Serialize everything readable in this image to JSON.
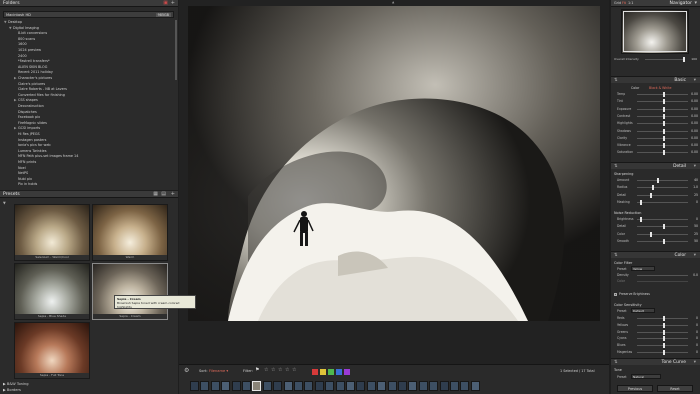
{
  "folders": {
    "title": "Folders",
    "volume_label": "Macintosh HD",
    "volume_size": "985GB",
    "tree": [
      {
        "label": "Desktop",
        "depth": 1,
        "arrow": "▼"
      },
      {
        "label": "Digital Imaging",
        "depth": 2,
        "arrow": "▼"
      },
      {
        "label": "8-bit conversions",
        "depth": 3,
        "arrow": ""
      },
      {
        "label": "800 scans",
        "depth": 3,
        "arrow": ""
      },
      {
        "label": "1600",
        "depth": 3,
        "arrow": ""
      },
      {
        "label": "1024 preview",
        "depth": 3,
        "arrow": ""
      },
      {
        "label": "2400",
        "depth": 3,
        "arrow": ""
      },
      {
        "label": "*Fastrell transfers*",
        "depth": 3,
        "arrow": ""
      },
      {
        "label": "ALIEN SKIN BLOG",
        "depth": 3,
        "arrow": ""
      },
      {
        "label": "Recent 2011 holiday",
        "depth": 3,
        "arrow": ""
      },
      {
        "label": "Character's pictures",
        "depth": 3,
        "arrow": "▶"
      },
      {
        "label": "Claire's pictures",
        "depth": 3,
        "arrow": ""
      },
      {
        "label": "Claire Roberts - NB at Lavers",
        "depth": 3,
        "arrow": ""
      },
      {
        "label": "Converted files for finishing",
        "depth": 3,
        "arrow": ""
      },
      {
        "label": "CSS shapes",
        "depth": 3,
        "arrow": "▶"
      },
      {
        "label": "Deconstruction",
        "depth": 3,
        "arrow": ""
      },
      {
        "label": "Dispatches",
        "depth": 3,
        "arrow": ""
      },
      {
        "label": "Facebook pix",
        "depth": 3,
        "arrow": ""
      },
      {
        "label": "FireMagnic slides",
        "depth": 3,
        "arrow": ""
      },
      {
        "label": "GCSI imports",
        "depth": 3,
        "arrow": "▶"
      },
      {
        "label": "Hi Res JPEGS",
        "depth": 3,
        "arrow": ""
      },
      {
        "label": "Instagen posters",
        "depth": 3,
        "arrow": ""
      },
      {
        "label": "Ionia's pics for web",
        "depth": 3,
        "arrow": ""
      },
      {
        "label": "Lumens Twinkles",
        "depth": 3,
        "arrow": ""
      },
      {
        "label": "MFN Path plus-set images frame 14",
        "depth": 3,
        "arrow": ""
      },
      {
        "label": "MFN prints",
        "depth": 3,
        "arrow": ""
      },
      {
        "label": "Noel",
        "depth": 3,
        "arrow": ""
      },
      {
        "label": "NetPS",
        "depth": 3,
        "arrow": ""
      },
      {
        "label": "Nubi pix",
        "depth": 3,
        "arrow": ""
      },
      {
        "label": "Pix in holds",
        "depth": 3,
        "arrow": ""
      }
    ]
  },
  "presets": {
    "title": "Presets",
    "items": [
      {
        "label": "Selenium - Warm/Cool",
        "tone": "warm"
      },
      {
        "label": "Warm",
        "tone": "warm2"
      },
      {
        "label": "Sepia - Blue Shade",
        "tone": "sepia"
      },
      {
        "label": "Sepia - Cream",
        "tone": "cream"
      },
      {
        "label": "Sepia - Full Tone",
        "tone": "full"
      }
    ],
    "tooltip_title": "Sepia - Cream",
    "tooltip_text": "Brownish Sepia toned with cream-colored highlights",
    "footer_1": "B&W Toning",
    "footer_2": "Borders"
  },
  "toolbar": {
    "sort_label": "Sort:",
    "sort_value": "Filename ▾",
    "filter_label": "Filter:",
    "status": "1 Selected / 17 Total",
    "stars": [
      "☆",
      "☆",
      "☆",
      "☆",
      "☆"
    ],
    "swatches": [
      "#d63a3a",
      "#e0c43a",
      "#4fb84f",
      "#3a6fd6",
      "#9b3ad6"
    ]
  },
  "navigator": {
    "title": "Navigator",
    "zoom_options": [
      "Grid",
      "Fit",
      "1:1"
    ],
    "overall_label": "Overall Intensity",
    "overall_value": "100"
  },
  "basic": {
    "title": "Basic",
    "color_label": "Color",
    "color_value": "Black & White",
    "rows": [
      {
        "name": "Temp",
        "value": "0.00",
        "pos": 50
      },
      {
        "name": "Tint",
        "value": "0.00",
        "pos": 50
      },
      {
        "name": "Exposure",
        "value": "0.00",
        "pos": 50
      },
      {
        "name": "Contrast",
        "value": "0.00",
        "pos": 50
      },
      {
        "name": "Highlights",
        "value": "0.00",
        "pos": 50
      },
      {
        "name": "Shadows",
        "value": "0.00",
        "pos": 50
      },
      {
        "name": "Clarity",
        "value": "0.00",
        "pos": 50
      },
      {
        "name": "Vibrance",
        "value": "0.00",
        "pos": 50
      },
      {
        "name": "Saturation",
        "value": "0.00",
        "pos": 50
      }
    ]
  },
  "detail": {
    "title": "Detail",
    "sharpening_label": "Sharpening",
    "sharpening_rows": [
      {
        "name": "Amount",
        "value": "40",
        "pos": 40
      },
      {
        "name": "Radius",
        "value": "1.0",
        "pos": 30
      },
      {
        "name": "Detail",
        "value": "25",
        "pos": 25
      },
      {
        "name": "Masking",
        "value": "0",
        "pos": 5
      }
    ],
    "noise_label": "Noise Reduction",
    "noise_rows": [
      {
        "name": "Brightness",
        "value": "0",
        "pos": 5
      },
      {
        "name": "Detail",
        "value": "50",
        "pos": 50
      },
      {
        "name": "Color",
        "value": "25",
        "pos": 25
      },
      {
        "name": "Smooth",
        "value": "50",
        "pos": 50
      }
    ]
  },
  "color": {
    "title": "Color",
    "filter_label": "Color Filter",
    "preset_label": "Preset",
    "preset_value": "Yellow",
    "density_label": "Density",
    "density_value": "0.0",
    "color_label": "Color",
    "luminance_label": "Preserve Brightness",
    "sensitivity_label": "Color Sensitivity",
    "sens_preset_value": "Default",
    "sens_rows": [
      {
        "name": "Reds",
        "value": "0",
        "pos": 50
      },
      {
        "name": "Yellows",
        "value": "0",
        "pos": 50
      },
      {
        "name": "Greens",
        "value": "0",
        "pos": 50
      },
      {
        "name": "Cyans",
        "value": "0",
        "pos": 50
      },
      {
        "name": "Blues",
        "value": "0",
        "pos": 50
      },
      {
        "name": "Magentas",
        "value": "0",
        "pos": 50
      }
    ]
  },
  "tone_curve": {
    "title": "Tone Curve",
    "tone_label": "Tone",
    "preset_label": "Preset",
    "preset_value": "Natural",
    "prev_label": "Previous",
    "reset_label": "Reset"
  }
}
